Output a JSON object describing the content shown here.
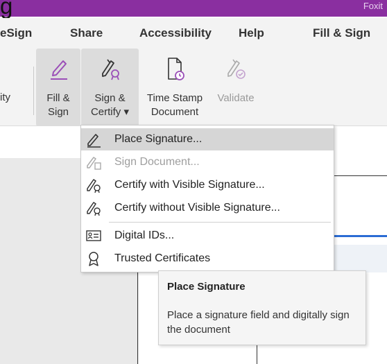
{
  "window": {
    "title_fragment": "Foxit",
    "partial_heading": "g"
  },
  "tabs": [
    "eSign",
    "Share",
    "Accessibility",
    "Help",
    "Fill & Sign"
  ],
  "ribbon": {
    "partial_label": "ity",
    "buttons": [
      {
        "label_line1": "Fill &",
        "label_line2": "Sign",
        "icon": "pen-icon",
        "selected": true
      },
      {
        "label_line1": "Sign &",
        "label_line2": "Certify ▾",
        "icon": "sign-certify-icon",
        "selected": true
      },
      {
        "label_line1": "Time Stamp",
        "label_line2": "Document",
        "icon": "time-stamp-icon"
      },
      {
        "label_line1": "Validate",
        "label_line2": "",
        "icon": "validate-icon",
        "disabled": true
      }
    ]
  },
  "dropdown": {
    "items": [
      {
        "label": "Place Signature...",
        "icon": "place-signature-icon",
        "highlighted": true
      },
      {
        "label": "Sign Document...",
        "icon": "sign-document-icon",
        "disabled": true
      },
      {
        "label": "Certify with Visible Signature...",
        "icon": "certify-visible-icon"
      },
      {
        "label": "Certify without Visible Signature...",
        "icon": "certify-invisible-icon"
      },
      {
        "label": "Digital IDs...",
        "icon": "digital-id-icon"
      },
      {
        "label": "Trusted Certificates",
        "icon": "trusted-certificate-icon"
      }
    ]
  },
  "tooltip": {
    "title": "Place Signature",
    "body": "Place a signature field and digitally sign the document"
  },
  "colors": {
    "titlebar": "#8a2fa0",
    "accent_blue": "#2b6cd4",
    "icon_purple": "#9b4fb8"
  }
}
